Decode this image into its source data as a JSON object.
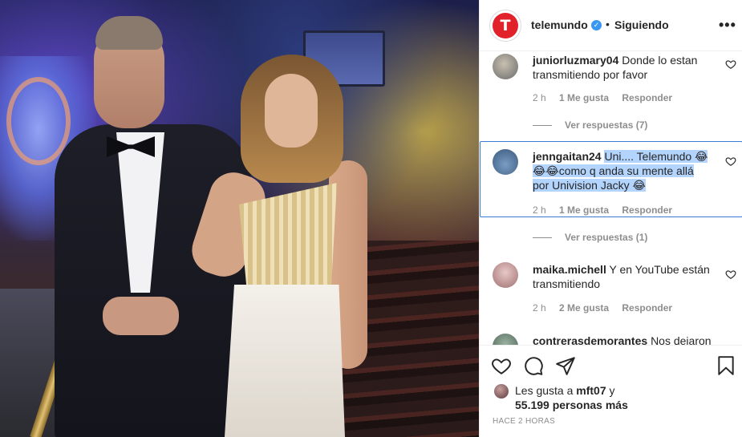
{
  "post": {
    "account": "telemundo",
    "avatar_letter": "T",
    "verified": true,
    "separator": "•",
    "follow_status": "Siguiendo",
    "more_icon": "more-options-icon"
  },
  "comments": [
    {
      "user": "juniorluzmary04",
      "text": "Donde lo estan transmitiendo por favor",
      "time": "2 h",
      "likes": "1 Me gusta",
      "reply": "Responder",
      "view_replies": "Ver respuestas (7)"
    },
    {
      "user": "jenngaitan24",
      "text_lines": [
        "Uni.... Telemundo 😂",
        "😂😂como q anda su mente allá",
        "por Univision Jacky 😂"
      ],
      "time": "2 h",
      "likes": "1 Me gusta",
      "reply": "Responder",
      "view_replies": "Ver respuestas (1)"
    },
    {
      "user": "maika.michell",
      "text": "Y en YouTube están transmitiendo",
      "time": "2 h",
      "likes": "2 Me gusta",
      "reply": "Responder"
    },
    {
      "user": "contrerasdemorantes",
      "text": "Nos dejaron"
    }
  ],
  "actions": {
    "icons": [
      "heart-icon",
      "comment-icon",
      "share-icon",
      "bookmark-icon"
    ],
    "likes_prefix": "Les gusta a",
    "likes_user": "mft07",
    "likes_conj": "y",
    "likes_count": "55.199 personas más",
    "time_ago": "HACE 2 HORAS"
  },
  "colors": {
    "brand": "#e1222b",
    "verified": "#3897f0",
    "selection": "#b3d4fc",
    "muted": "#8e8e8e"
  }
}
